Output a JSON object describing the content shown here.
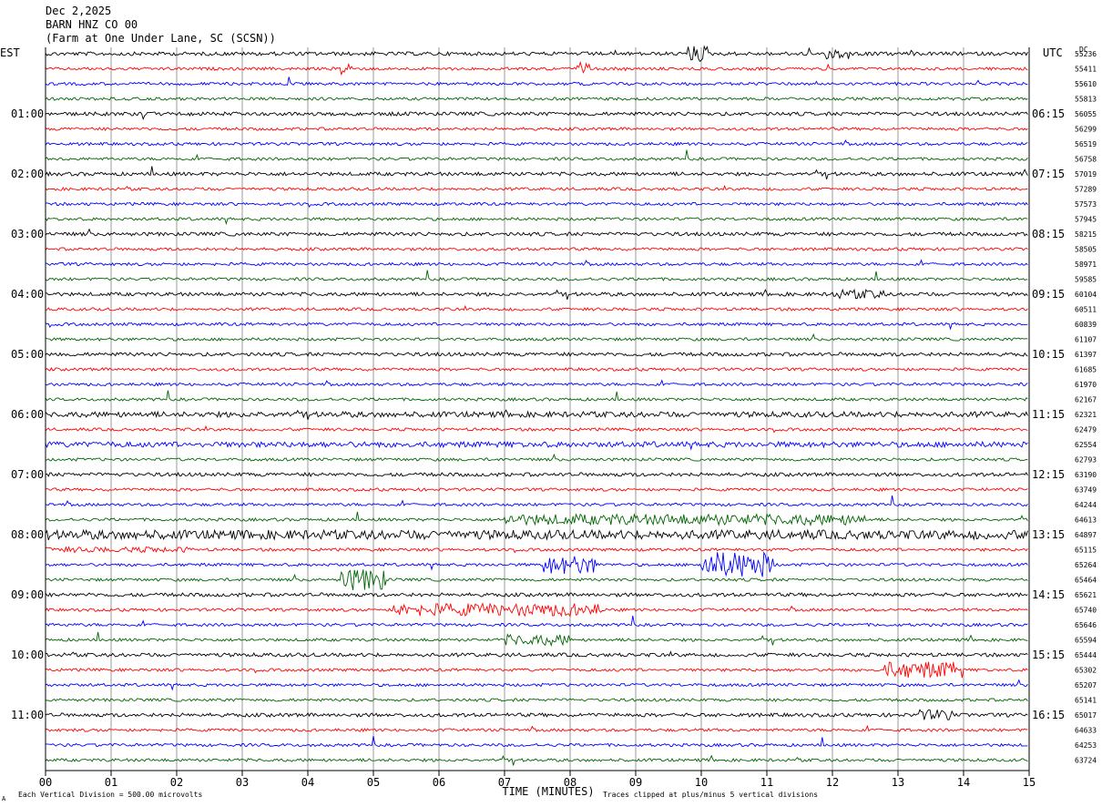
{
  "header": {
    "date": "Dec 2,2025",
    "station": "BARN HNZ CO 00",
    "location": "(Farm at One Under Lane, SC (SCSN))"
  },
  "chart_data": {
    "type": "line",
    "title": "BARN HNZ CO 00",
    "left_timezone": "EST",
    "right_timezone": "UTC",
    "dc_label": "DC",
    "xlabel": "TIME (MINUTES)",
    "xlim": [
      0,
      15
    ],
    "x_ticks": [
      "00",
      "01",
      "02",
      "03",
      "04",
      "05",
      "06",
      "07",
      "08",
      "09",
      "10",
      "11",
      "12",
      "13",
      "14",
      "15"
    ],
    "grid": true,
    "left_hour_labels": [
      "01:00",
      "02:00",
      "03:00",
      "04:00",
      "05:00",
      "06:00",
      "07:00",
      "08:00",
      "09:00",
      "10:00",
      "11:00"
    ],
    "right_hour_labels": [
      "06:15",
      "07:15",
      "08:15",
      "09:15",
      "10:15",
      "11:15",
      "12:15",
      "13:15",
      "14:15",
      "15:15",
      "16:15"
    ],
    "trace_colors": [
      "#000000",
      "#ff0000",
      "#0000ff",
      "#006400"
    ],
    "dc_offsets": [
      55236,
      55411,
      55610,
      55813,
      56055,
      56299,
      56519,
      56758,
      57019,
      57289,
      57573,
      57945,
      58215,
      58505,
      58971,
      59585,
      60104,
      60511,
      60839,
      61107,
      61397,
      61685,
      61970,
      62167,
      62321,
      62479,
      62554,
      62793,
      63190,
      63749,
      64244,
      64613,
      64897,
      65115,
      65264,
      65464,
      65621,
      65740,
      65646,
      65594,
      65444,
      65302,
      65207,
      65141,
      65017,
      64633,
      64253,
      63724
    ],
    "footer_left": "Each Vertical Division =  500.00 microvolts",
    "footer_right": "Traces clipped at plus/minus 5 vertical divisions",
    "footer_mark": "A"
  }
}
